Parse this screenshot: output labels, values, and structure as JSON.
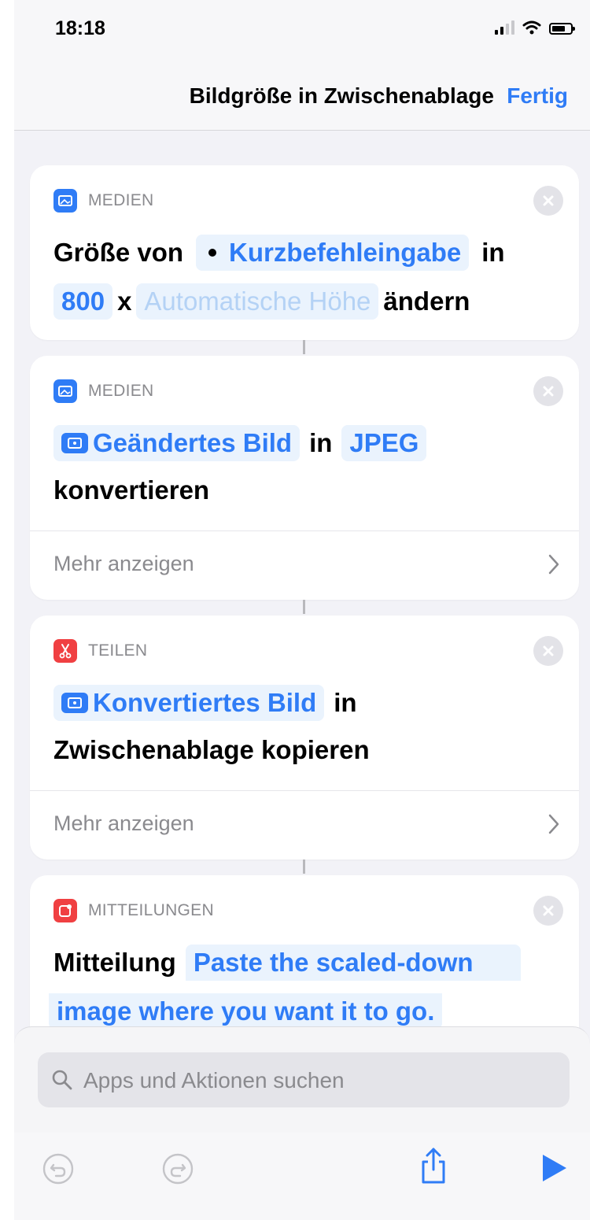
{
  "status": {
    "time": "18:18"
  },
  "nav": {
    "title": "Bildgröße in Zwischenablage",
    "done": "Fertig"
  },
  "actions": [
    {
      "category": "MEDIEN",
      "line1": {
        "t1": "Größe von",
        "v1": "Kurzbefehleingabe",
        "t2": "in"
      },
      "line2": {
        "v1": "800",
        "t1": "x",
        "v2": "Automatische Höhe",
        "t2": "ändern"
      }
    },
    {
      "category": "MEDIEN",
      "line1": {
        "v1": "Geändertes Bild",
        "t1": "in",
        "v2": "JPEG"
      },
      "line2": {
        "t1": "konvertieren"
      },
      "more": "Mehr anzeigen"
    },
    {
      "category": "TEILEN",
      "line1": {
        "v1": "Konvertiertes Bild",
        "t1": "in"
      },
      "line2": {
        "t1": "Zwischenablage kopieren"
      },
      "more": "Mehr anzeigen"
    },
    {
      "category": "MITTEILUNGEN",
      "line1": {
        "t1": "Mitteilung",
        "v1": "Paste the scaled-down"
      },
      "line2": {
        "v1": "image where you want it to go."
      }
    }
  ],
  "search": {
    "placeholder": "Apps und Aktionen suchen"
  },
  "colors": {
    "accent": "#2f7cf6",
    "media": "#2f7cf6",
    "share": "#f04042",
    "notifications": "#f04042"
  },
  "toolbar": {
    "icons": [
      "undo-icon",
      "redo-icon",
      "share-icon",
      "play-icon"
    ]
  }
}
